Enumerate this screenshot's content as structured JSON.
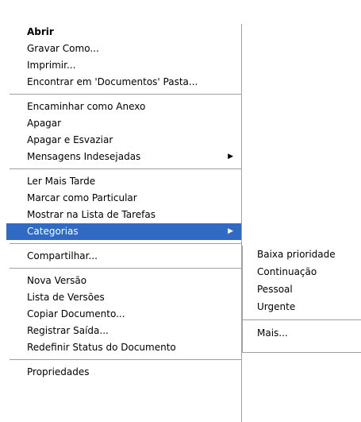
{
  "context_menu": {
    "groups": [
      {
        "items": [
          {
            "label": "Abrir",
            "bold": true
          },
          {
            "label": "Gravar Como..."
          },
          {
            "label": "Imprimir..."
          },
          {
            "label": "Encontrar em 'Documentos' Pasta..."
          }
        ]
      },
      {
        "items": [
          {
            "label": "Encaminhar como Anexo"
          },
          {
            "label": "Apagar"
          },
          {
            "label": "Apagar e Esvaziar"
          },
          {
            "label": "Mensagens Indesejadas",
            "submenu_arrow": "▶"
          }
        ]
      },
      {
        "items": [
          {
            "label": "Ler Mais Tarde"
          },
          {
            "label": "Marcar como Particular"
          },
          {
            "label": "Mostrar na Lista de Tarefas"
          },
          {
            "label": "Categorias",
            "highlighted": true,
            "submenu_arrow": "▶"
          }
        ]
      },
      {
        "items": [
          {
            "label": "Compartilhar..."
          }
        ]
      },
      {
        "items": [
          {
            "label": "Nova Versão"
          },
          {
            "label": "Lista de Versões"
          },
          {
            "label": "Copiar Documento..."
          },
          {
            "label": "Registrar Saída..."
          },
          {
            "label": "Redefinir Status do Documento"
          }
        ]
      },
      {
        "items": [
          {
            "label": "Propriedades"
          }
        ]
      }
    ]
  },
  "categories_submenu": {
    "items": [
      {
        "label": "Baixa prioridade"
      },
      {
        "label": "Continuação"
      },
      {
        "label": "Pessoal"
      },
      {
        "label": "Urgente"
      }
    ],
    "more_label": "Mais..."
  },
  "colors": {
    "highlight": "#316ac5",
    "highlight_text": "#ffffff",
    "separator": "#a0a0a0"
  }
}
